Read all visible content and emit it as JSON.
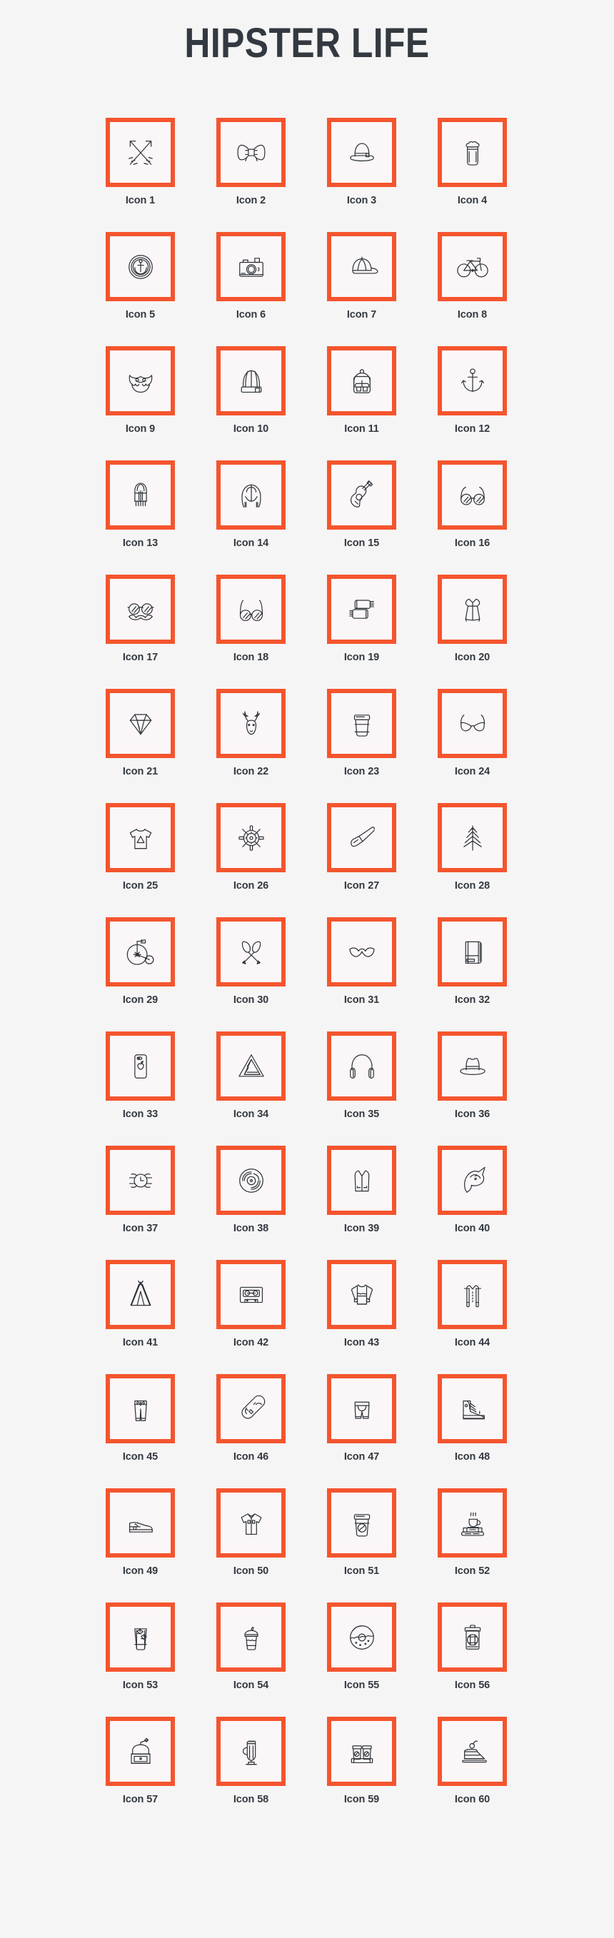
{
  "header": {
    "title": "HIPSTER LIFE"
  },
  "theme": {
    "page_background": "#f5f5f5",
    "box_border_color": "#f4552e",
    "box_fill_color": "#fbf7f9",
    "icon_stroke_color": "#2e3238",
    "text_color": "#333940"
  },
  "grid": {
    "columns": 4,
    "rows": 15,
    "total_icons": 60
  },
  "icons": [
    {
      "label": "Icon 1",
      "icon": "crossed-arrows-icon"
    },
    {
      "label": "Icon 2",
      "icon": "bow-tie-icon"
    },
    {
      "label": "Icon 3",
      "icon": "bowler-hat-icon"
    },
    {
      "label": "Icon 4",
      "icon": "beer-glass-icon"
    },
    {
      "label": "Icon 5",
      "icon": "anchor-badge-icon"
    },
    {
      "label": "Icon 6",
      "icon": "camera-icon"
    },
    {
      "label": "Icon 7",
      "icon": "baseball-cap-icon"
    },
    {
      "label": "Icon 8",
      "icon": "bicycle-icon"
    },
    {
      "label": "Icon 9",
      "icon": "beard-icon"
    },
    {
      "label": "Icon 10",
      "icon": "beanie-hat-icon"
    },
    {
      "label": "Icon 11",
      "icon": "backpack-icon"
    },
    {
      "label": "Icon 12",
      "icon": "anchor-icon"
    },
    {
      "label": "Icon 13",
      "icon": "lantern-icon"
    },
    {
      "label": "Icon 14",
      "icon": "hoodie-icon"
    },
    {
      "label": "Icon 15",
      "icon": "acoustic-guitar-icon"
    },
    {
      "label": "Icon 16",
      "icon": "round-sunglasses-icon"
    },
    {
      "label": "Icon 17",
      "icon": "glasses-mustache-icon"
    },
    {
      "label": "Icon 18",
      "icon": "eyeglasses-icon"
    },
    {
      "label": "Icon 19",
      "icon": "scarf-icon"
    },
    {
      "label": "Icon 20",
      "icon": "dress-icon"
    },
    {
      "label": "Icon 21",
      "icon": "diamond-icon"
    },
    {
      "label": "Icon 22",
      "icon": "deer-head-icon"
    },
    {
      "label": "Icon 23",
      "icon": "coffee-cup-icon"
    },
    {
      "label": "Icon 24",
      "icon": "cat-eye-sunglasses-icon"
    },
    {
      "label": "Icon 25",
      "icon": "t-shirt-icon"
    },
    {
      "label": "Icon 26",
      "icon": "ship-wheel-icon"
    },
    {
      "label": "Icon 27",
      "icon": "smoking-pipe-icon"
    },
    {
      "label": "Icon 28",
      "icon": "pine-tree-icon"
    },
    {
      "label": "Icon 29",
      "icon": "penny-farthing-icon"
    },
    {
      "label": "Icon 30",
      "icon": "crossed-oars-icon"
    },
    {
      "label": "Icon 31",
      "icon": "mustache-icon"
    },
    {
      "label": "Icon 32",
      "icon": "notebook-icon"
    },
    {
      "label": "Icon 33",
      "icon": "smartphone-icon"
    },
    {
      "label": "Icon 34",
      "icon": "penrose-triangle-icon"
    },
    {
      "label": "Icon 35",
      "icon": "headphones-icon"
    },
    {
      "label": "Icon 36",
      "icon": "fedora-hat-icon"
    },
    {
      "label": "Icon 37",
      "icon": "wristwatch-icon"
    },
    {
      "label": "Icon 38",
      "icon": "vinyl-record-icon"
    },
    {
      "label": "Icon 39",
      "icon": "vest-icon"
    },
    {
      "label": "Icon 40",
      "icon": "unicorn-head-icon"
    },
    {
      "label": "Icon 41",
      "icon": "teepee-tent-icon"
    },
    {
      "label": "Icon 42",
      "icon": "cassette-tape-icon"
    },
    {
      "label": "Icon 43",
      "icon": "sweater-icon"
    },
    {
      "label": "Icon 44",
      "icon": "suspenders-icon"
    },
    {
      "label": "Icon 45",
      "icon": "jeans-icon"
    },
    {
      "label": "Icon 46",
      "icon": "skateboard-icon"
    },
    {
      "label": "Icon 47",
      "icon": "shorts-icon"
    },
    {
      "label": "Icon 48",
      "icon": "high-top-sneaker-icon"
    },
    {
      "label": "Icon 49",
      "icon": "dress-shoe-icon"
    },
    {
      "label": "Icon 50",
      "icon": "polo-shirt-icon"
    },
    {
      "label": "Icon 51",
      "icon": "coffee-cup-bean-icon"
    },
    {
      "label": "Icon 52",
      "icon": "coffee-on-books-icon"
    },
    {
      "label": "Icon 53",
      "icon": "iced-drink-icon"
    },
    {
      "label": "Icon 54",
      "icon": "smoothie-cup-icon"
    },
    {
      "label": "Icon 55",
      "icon": "donut-icon"
    },
    {
      "label": "Icon 56",
      "icon": "coffee-jar-icon"
    },
    {
      "label": "Icon 57",
      "icon": "coffee-grinder-icon"
    },
    {
      "label": "Icon 58",
      "icon": "latte-glass-icon"
    },
    {
      "label": "Icon 59",
      "icon": "coffee-cup-carrier-icon"
    },
    {
      "label": "Icon 60",
      "icon": "cake-slice-icon"
    }
  ]
}
